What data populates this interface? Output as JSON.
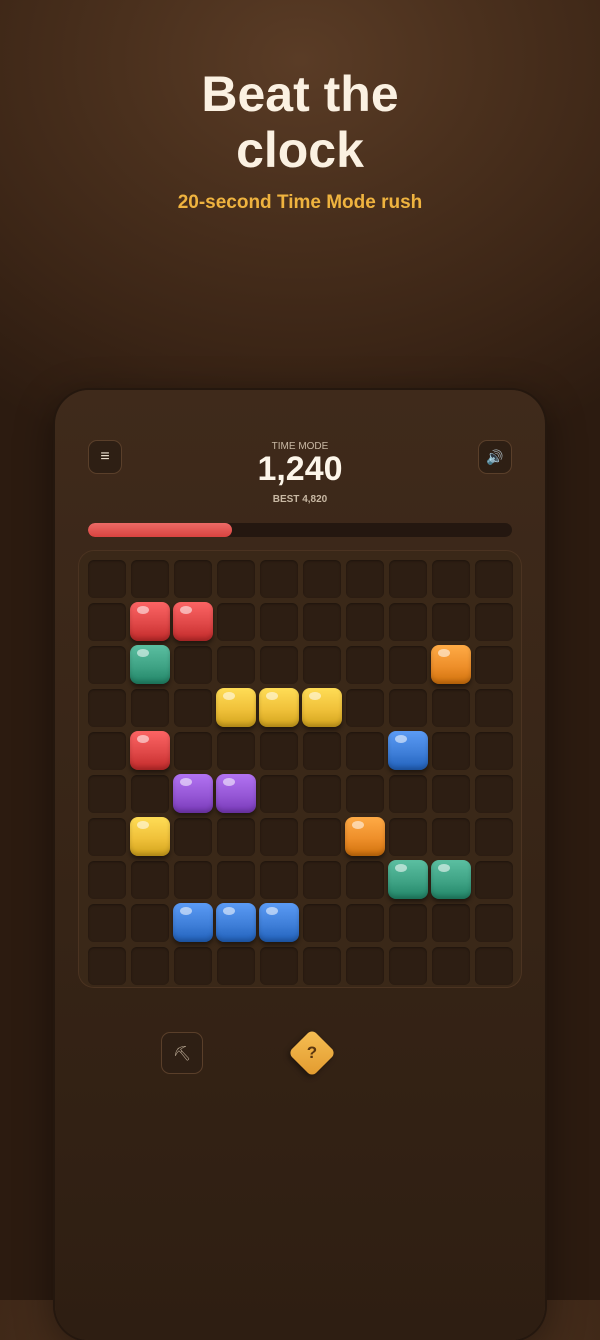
{
  "promo": {
    "title_line1": "Beat the",
    "title_line2": "clock",
    "subtitle": "20-second Time Mode rush"
  },
  "header": {
    "menu_icon_glyph": "≡",
    "sound_icon_glyph": "🔊",
    "mode_label": "TIME MODE",
    "score": "1,240",
    "best": "BEST 4,820"
  },
  "timer": {
    "remaining_fraction": 0.34
  },
  "board": {
    "rows": 10,
    "cols": 10,
    "blocks": [
      {
        "row": 1,
        "col": 1,
        "color": "red"
      },
      {
        "row": 1,
        "col": 2,
        "color": "red"
      },
      {
        "row": 2,
        "col": 1,
        "color": "green"
      },
      {
        "row": 2,
        "col": 8,
        "color": "orange"
      },
      {
        "row": 3,
        "col": 3,
        "color": "yellow"
      },
      {
        "row": 3,
        "col": 4,
        "color": "yellow"
      },
      {
        "row": 3,
        "col": 5,
        "color": "yellow"
      },
      {
        "row": 4,
        "col": 1,
        "color": "red"
      },
      {
        "row": 4,
        "col": 7,
        "color": "blue"
      },
      {
        "row": 5,
        "col": 2,
        "color": "purple"
      },
      {
        "row": 5,
        "col": 3,
        "color": "purple"
      },
      {
        "row": 6,
        "col": 1,
        "color": "yellow"
      },
      {
        "row": 6,
        "col": 6,
        "color": "orange"
      },
      {
        "row": 7,
        "col": 7,
        "color": "green"
      },
      {
        "row": 7,
        "col": 8,
        "color": "green"
      },
      {
        "row": 8,
        "col": 2,
        "color": "blue"
      },
      {
        "row": 8,
        "col": 3,
        "color": "blue"
      },
      {
        "row": 8,
        "col": 4,
        "color": "blue"
      }
    ]
  },
  "colors": {
    "red": "#e04848",
    "green": "#3fa385",
    "orange": "#ee8f2a",
    "yellow": "#f0c13a",
    "blue": "#3f7fd9",
    "purple": "#9657d6",
    "accent": "#efb33f",
    "timer": "#e0504c"
  },
  "powerups": {
    "hammer_icon_glyph": "⛏",
    "hint_label": "?"
  }
}
